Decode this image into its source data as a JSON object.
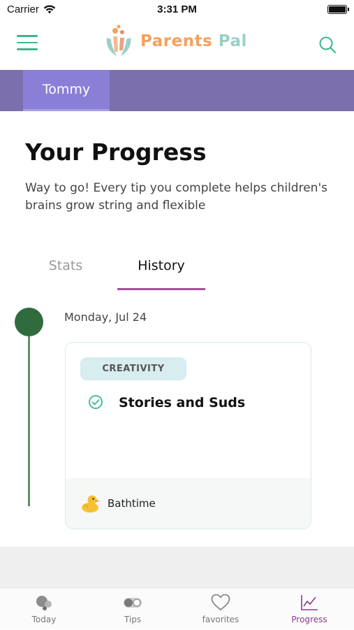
{
  "status_bar": {
    "carrier": "Carrier",
    "time": "3:31 PM"
  },
  "header": {
    "logo_text_part1": "Parents",
    "logo_text_part2": "Pal"
  },
  "child_selector": {
    "selected": "Tommy"
  },
  "page": {
    "title": "Your Progress",
    "subtitle": "Way to go! Every tip you complete helps children's brains grow string and flexible"
  },
  "tabs": [
    {
      "label": "Stats",
      "active": false
    },
    {
      "label": "History",
      "active": true
    }
  ],
  "history": [
    {
      "date": "Monday, Jul 24",
      "category": "CREATIVITY",
      "tip_title": "Stories and Suds",
      "routine": "Bathtime"
    }
  ],
  "bottom_nav": [
    {
      "label": "Today",
      "icon": "today-icon",
      "active": false
    },
    {
      "label": "Tips",
      "icon": "tips-icon",
      "active": false
    },
    {
      "label": "favorites",
      "icon": "heart-icon",
      "active": false
    },
    {
      "label": "Progress",
      "icon": "chart-line-icon",
      "active": true
    }
  ],
  "colors": {
    "accent_green": "#3cb88a",
    "purple_bar": "#7b6fae",
    "purple_tab": "#8a7fd6",
    "history_underline": "#a0509a",
    "timeline_dot": "#2f6b3d",
    "badge_bg": "#d7edf0",
    "active_nav": "#8a3c8e"
  }
}
